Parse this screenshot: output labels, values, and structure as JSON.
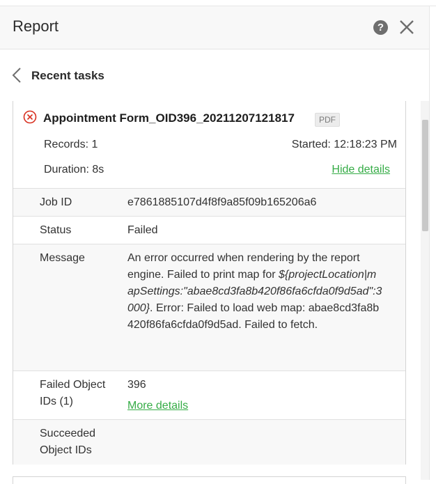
{
  "header": {
    "title": "Report",
    "help_icon_label": "?"
  },
  "nav": {
    "back_label": "Recent tasks"
  },
  "task": {
    "title": "Appointment Form_OID396_20211207121817",
    "format_badge": "PDF",
    "records": "Records: 1",
    "started": "Started: 12:18:23 PM",
    "duration": "Duration: 8s",
    "hide_details": "Hide details",
    "status_color": "#d83020"
  },
  "details": {
    "job_id_label": "Job ID",
    "job_id_value": "e7861885107d4f8f9a85f09b165206a6",
    "status_label": "Status",
    "status_value": "Failed",
    "message_label": "Message",
    "message_part1": "An error occurred when rendering by the report engine. Failed to print map for ",
    "message_italic": "${projectLocation|mapSettings:\"abae8cd3fa8b420f86fa6cfda0f9d5ad\":3000}",
    "message_part2": ". Error: Failed to load web map: abae8cd3fa8b420f86fa6cfda0f9d5ad. Failed to fetch.",
    "failed_label_line1": "Failed Object",
    "failed_label_line2": "IDs (1)",
    "failed_value": "396",
    "more_details": "More details",
    "succeeded_label_line1": "Succeeded",
    "succeeded_label_line2": "Object IDs"
  },
  "colors": {
    "link": "#35ac46",
    "error": "#d83020"
  }
}
